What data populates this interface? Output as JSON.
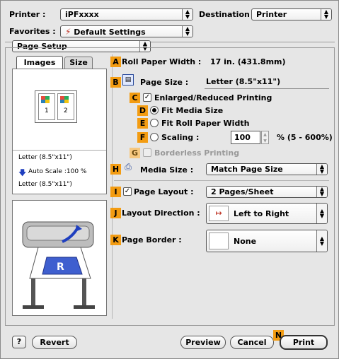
{
  "header": {
    "printer_label": "Printer :",
    "printer_value": "iPFxxxx",
    "destination_label": "Destination :",
    "destination_value": "Printer",
    "favorites_label": "Favorites :",
    "favorites_value": "Default Settings"
  },
  "panel_select": {
    "value": "Page Setup"
  },
  "tabs": [
    {
      "label": "Images"
    },
    {
      "label": "Size"
    }
  ],
  "preview": {
    "page1": "1",
    "page2": "2",
    "info_lines": [
      "Letter (8.5\"x11\")",
      "Auto Scale :100 %",
      "Letter (8.5\"x11\")"
    ]
  },
  "badges": {
    "A": "A",
    "B": "B",
    "C": "C",
    "D": "D",
    "E": "E",
    "F": "F",
    "G": "G",
    "H": "H",
    "I": "I",
    "J": "J",
    "K": "K",
    "N": "N"
  },
  "settings": {
    "roll_paper_width_label": "Roll Paper Width :",
    "roll_paper_width_value": "17 in. (431.8mm)",
    "page_size_label": "Page Size :",
    "page_size_value": "Letter (8.5\"x11\")",
    "enlarged_label": "Enlarged/Reduced Printing",
    "fit_media_label": "Fit Media Size",
    "fit_roll_label": "Fit Roll Paper Width",
    "scaling_label": "Scaling :",
    "scaling_value": "100",
    "scaling_range": "% (5 - 600%)",
    "borderless_label": "Borderless Printing",
    "media_size_label": "Media Size :",
    "media_size_value": "Match Page Size",
    "page_layout_label": "Page Layout :",
    "page_layout_value": "2 Pages/Sheet",
    "layout_direction_label": "Layout Direction :",
    "layout_direction_value": "Left to Right",
    "page_border_label": "Page Border :",
    "page_border_value": "None"
  },
  "footer": {
    "help": "?",
    "revert": "Revert",
    "preview": "Preview",
    "cancel": "Cancel",
    "print": "Print"
  }
}
